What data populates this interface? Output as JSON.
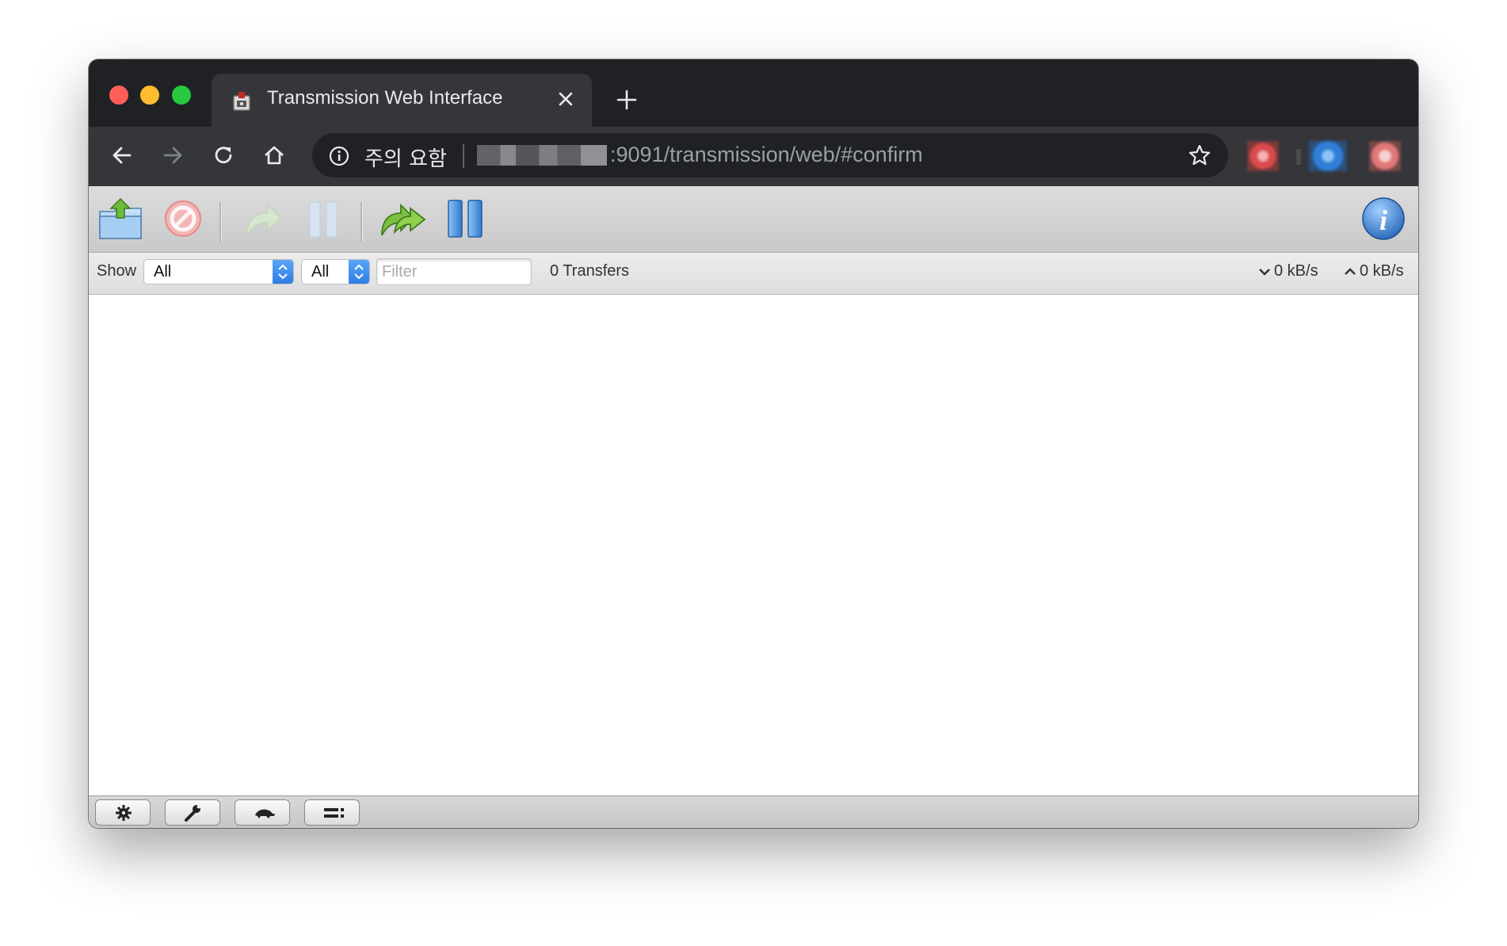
{
  "browser": {
    "tab": {
      "title": "Transmission Web Interface"
    },
    "omnibox": {
      "security_label": "주의 요함",
      "url_visible": ":9091/transmission/web/#confirm"
    }
  },
  "app": {
    "filter_bar": {
      "show_label": "Show",
      "status_filter": {
        "selected": "All"
      },
      "tracker_filter": {
        "selected": "All"
      },
      "filter_placeholder": "Filter",
      "transfers_count": "0 Transfers",
      "download_rate": "0 kB/s",
      "upload_rate": "0 kB/s"
    }
  },
  "colors": {
    "chrome_dark": "#202124",
    "chrome_tab": "#35363a",
    "accent_blue": "#2f7de6"
  }
}
